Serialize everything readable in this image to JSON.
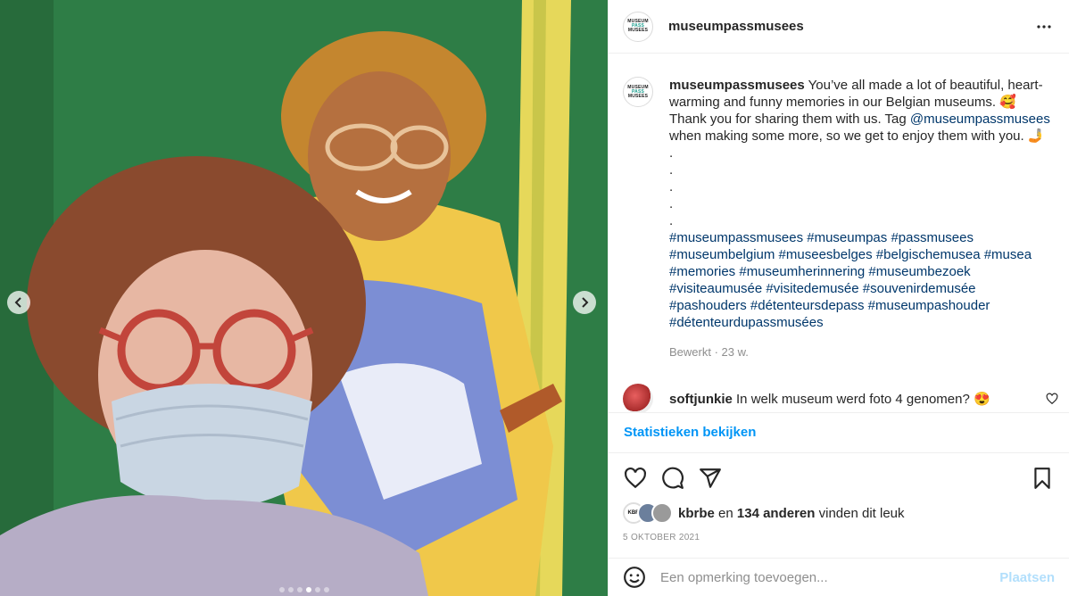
{
  "post": {
    "username": "museumpassmusees",
    "logo_lines": [
      "MUSEUM",
      "PASS",
      "MUSEES"
    ],
    "more_icon": "more-horizontal-icon",
    "image_alt": "Woman with face mask posing in front of a painted portrait",
    "carousel": {
      "slide_count": 6,
      "active_index": 3,
      "prev_icon": "chevron-left-icon",
      "next_icon": "chevron-right-icon"
    }
  },
  "caption": {
    "username": "museumpassmusees",
    "text_1": " You’ve all made a lot of beautiful, heart-warming and funny memories in our Belgian museums. 🥰 Thank you for sharing them with us. Tag ",
    "mention": "@museumpassmusees",
    "text_2": " when making some more, so we get to enjoy them with you. 🤳",
    "dots": [
      ".",
      ".",
      ".",
      ".",
      "."
    ],
    "hashtags": "#museumpassmusees #museumpas #passmusees #museumbelgium #museesbelges #belgischemusea #musea #memories #museumherinnering #museumbezoek #visiteaumusée #visitedemusée #souvenirdemusée #pashouders #détenteursdepass #museumpashouder #détenteurdupassmusées",
    "meta": "Bewerkt · 23 w."
  },
  "comment": {
    "username": "softjunkie",
    "text": " In welk museum werd foto 4 genomen? 😍",
    "like_icon": "heart-outline-icon"
  },
  "stats_link": "Statistieken bekijken",
  "actions": {
    "like_icon": "heart-icon",
    "comment_icon": "comment-icon",
    "share_icon": "paper-plane-icon",
    "save_icon": "bookmark-icon"
  },
  "likes": {
    "first_liker_badge": "KBR",
    "user": "kbrbe",
    "middle": " en ",
    "others": "134 anderen",
    "suffix": " vinden dit leuk"
  },
  "date": "5 OKTOBER 2021",
  "add_comment": {
    "placeholder": "Een opmerking toevoegen...",
    "post_label": "Plaatsen",
    "emoji_icon": "smiley-icon"
  },
  "colors": {
    "link_blue": "#0095f6",
    "hashtag_blue": "#00376b",
    "muted_gray": "#8e8e8e",
    "border": "#efefef"
  }
}
